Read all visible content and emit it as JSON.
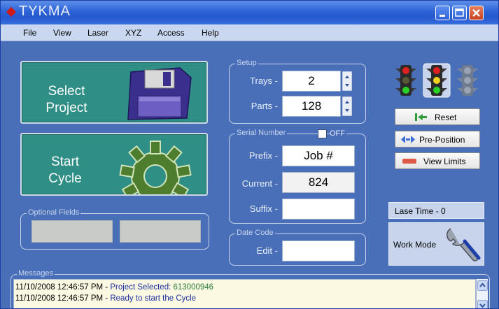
{
  "window": {
    "title": "TYKMA"
  },
  "menu": [
    "File",
    "View",
    "Laser",
    "XYZ",
    "Access",
    "Help"
  ],
  "buttons": {
    "select_project": [
      "Select",
      "Project"
    ],
    "start_cycle": [
      "Start",
      "Cycle"
    ],
    "reset": "Reset",
    "pre_position": "Pre-Position",
    "view_limits": "View Limits"
  },
  "optional_fields": {
    "legend": "Optional Fields"
  },
  "setup": {
    "legend": "Setup",
    "trays_label": "Trays -",
    "trays_value": "2",
    "parts_label": "Parts -",
    "parts_value": "128"
  },
  "serial": {
    "legend": "Serial Number",
    "toggle_label": "OFF",
    "prefix_label": "Prefix -",
    "prefix_value": "Job #",
    "current_label": "Current -",
    "current_value": "824",
    "suffix_label": "Suffix -",
    "suffix_value": ""
  },
  "date_code": {
    "legend": "Date Code",
    "edit_label": "Edit -",
    "edit_value": ""
  },
  "lase_time": "Lase Time - 0",
  "work_mode": "Work Mode",
  "messages": {
    "legend": "Messages",
    "lines": [
      {
        "timestamp": "11/10/2008 12:46:57 PM",
        "sep": "-",
        "text": "Project Selected:",
        "value": "613000946"
      },
      {
        "timestamp": "11/10/2008 12:46:57 PM",
        "sep": "-",
        "text": "Ready to start the Cycle",
        "value": ""
      }
    ]
  },
  "colors": {
    "window_bg": "#4a6fb9",
    "title_bar": "#2d63d6",
    "button_teal": "#2f8e86",
    "message_bg": "#fcf9e3",
    "message_text": "#1b2f9f"
  }
}
